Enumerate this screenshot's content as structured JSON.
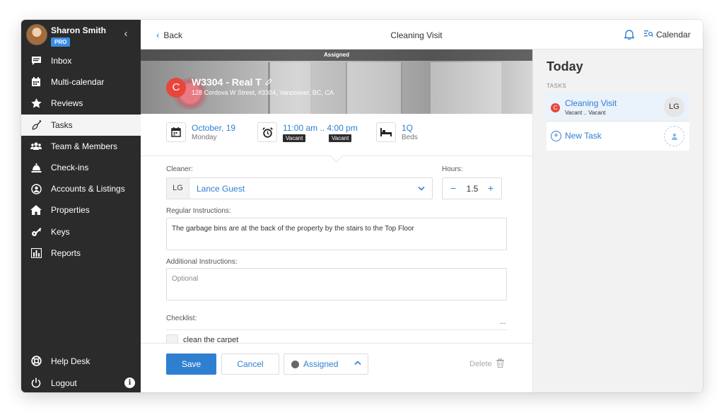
{
  "user": {
    "name": "Sharon Smith",
    "badge": "PRO"
  },
  "sidebar": {
    "items": [
      {
        "label": "Inbox",
        "icon": "inbox-icon"
      },
      {
        "label": "Multi-calendar",
        "icon": "calendar-grid-icon"
      },
      {
        "label": "Reviews",
        "icon": "star-icon"
      },
      {
        "label": "Tasks",
        "icon": "broom-icon",
        "active": true
      },
      {
        "label": "Team & Members",
        "icon": "team-icon"
      },
      {
        "label": "Check-ins",
        "icon": "bell-checkin-icon"
      },
      {
        "label": "Accounts & Listings",
        "icon": "account-icon"
      },
      {
        "label": "Properties",
        "icon": "home-icon"
      },
      {
        "label": "Keys",
        "icon": "key-icon"
      },
      {
        "label": "Reports",
        "icon": "bar-chart-icon"
      }
    ],
    "bottom": [
      {
        "label": "Help Desk",
        "icon": "lifebuoy-icon"
      },
      {
        "label": "Logout",
        "icon": "power-icon"
      }
    ],
    "info": "i"
  },
  "topbar": {
    "back_label": "Back",
    "title": "Cleaning Visit",
    "calendar_label": "Calendar"
  },
  "hero": {
    "status": "Assigned",
    "badge": "C",
    "property_name": "W3304 - Real T",
    "address": "128 Cordova W Street, #3304, Vancouver, BC, CA"
  },
  "info": {
    "date": "October, 19",
    "weekday": "Monday",
    "time": "11:00 am .. 4:00 pm",
    "vacant_start": "Vacant",
    "vacant_end": "Vacant",
    "beds": "1Q",
    "beds_label": "Beds"
  },
  "form": {
    "cleaner_label": "Cleaner:",
    "cleaner_initials": "LG",
    "cleaner_value": "Lance Guest",
    "hours_label": "Hours:",
    "hours_minus": "−",
    "hours_value": "1.5",
    "hours_plus": "+",
    "regular_label": "Regular Instructions:",
    "regular_value": "The garbage bins are at the back of the property by the stairs to the Top Floor",
    "additional_label": "Additional Instructions:",
    "additional_placeholder": "Optional",
    "checklist_label": "Checklist:",
    "checklist_more": "...",
    "checklist_items": [
      {
        "label": "clean the carpet",
        "checked": false
      }
    ]
  },
  "footer": {
    "save": "Save",
    "cancel": "Cancel",
    "status": "Assigned",
    "delete": "Delete"
  },
  "right": {
    "title": "Today",
    "section": "TASKS",
    "task": {
      "badge": "C",
      "name": "Cleaning Visit",
      "sub": "Vacant .. Vacant",
      "initials": "LG"
    },
    "new_task": "New Task"
  },
  "colors": {
    "accent": "#2f7fd1",
    "sidebar": "#2b2b2b",
    "badge_red": "#e8453c",
    "pro": "#3a8ee6"
  }
}
